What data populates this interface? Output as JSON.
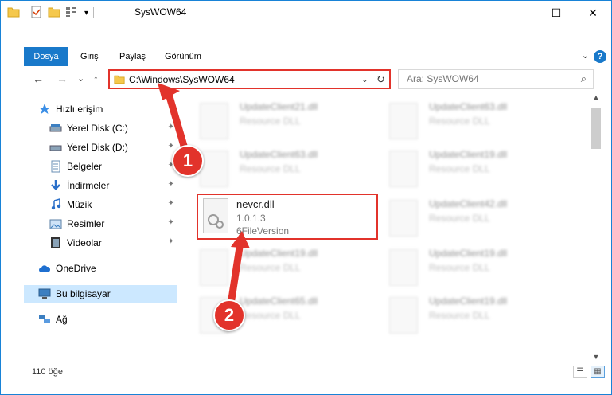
{
  "window": {
    "title": "SysWOW64",
    "minimize_glyph": "—",
    "maximize_glyph": "☐",
    "close_glyph": "✕"
  },
  "ribbon": {
    "tabs": [
      {
        "label": "Dosya"
      },
      {
        "label": "Giriş"
      },
      {
        "label": "Paylaş"
      },
      {
        "label": "Görünüm"
      }
    ],
    "help_glyph": "?"
  },
  "nav": {
    "back_glyph": "←",
    "forward_glyph": "→",
    "recent_glyph": "⌄",
    "up_glyph": "↑"
  },
  "address": {
    "path": "C:\\Windows\\SysWOW64",
    "dropdown_glyph": "⌄",
    "refresh_glyph": "↻"
  },
  "search": {
    "placeholder": "Ara: SysWOW64",
    "icon": "search-icon"
  },
  "sidebar": {
    "quick_access": "Hızlı erişim",
    "items": [
      {
        "label": "Yerel Disk (C:)",
        "icon": "drive-icon",
        "pinned": true
      },
      {
        "label": "Yerel Disk (D:)",
        "icon": "drive-icon",
        "pinned": true
      },
      {
        "label": "Belgeler",
        "icon": "documents-icon",
        "pinned": true
      },
      {
        "label": "İndirmeler",
        "icon": "download-icon",
        "pinned": true
      },
      {
        "label": "Müzik",
        "icon": "music-icon",
        "pinned": true
      },
      {
        "label": "Resimler",
        "icon": "pictures-icon",
        "pinned": true
      },
      {
        "label": "Videolar",
        "icon": "videos-icon",
        "pinned": true
      }
    ],
    "onedrive": "OneDrive",
    "this_pc": "Bu bilgisayar",
    "network": "Ağ",
    "pin_glyph": "📌"
  },
  "files": {
    "left_column": [
      {
        "name": "UpdateClient21.dll",
        "desc": "Resource DLL"
      },
      {
        "name": "UpdateClient63.dll",
        "desc": "Resource DLL"
      },
      {
        "name": "UpdateClient19.dll",
        "desc": "Resource DLL"
      },
      {
        "name": "UpdateClient65.dll",
        "desc": "Resource DLL"
      }
    ],
    "right_column": [
      {
        "name": "UpdateClient63.dll",
        "desc": "Resource DLL"
      },
      {
        "name": "UpdateClient19.dll",
        "desc": "Resource DLL"
      },
      {
        "name": "UpdateClient42.dll",
        "desc": "Resource DLL"
      },
      {
        "name": "UpdateClient19.dll",
        "desc": "Resource DLL"
      },
      {
        "name": "UpdateClient19.dll",
        "desc": "Resource DLL"
      }
    ],
    "highlighted": {
      "name": "nevcr.dll",
      "version": "1.0.1.3",
      "type": "6FileVersion"
    }
  },
  "statusbar": {
    "item_count": "110 öğe"
  },
  "callouts": [
    {
      "number": "1"
    },
    {
      "number": "2"
    }
  ],
  "colors": {
    "accent": "#1979ca",
    "highlight_red": "#e2332b",
    "selected_bg": "#cce8ff"
  }
}
